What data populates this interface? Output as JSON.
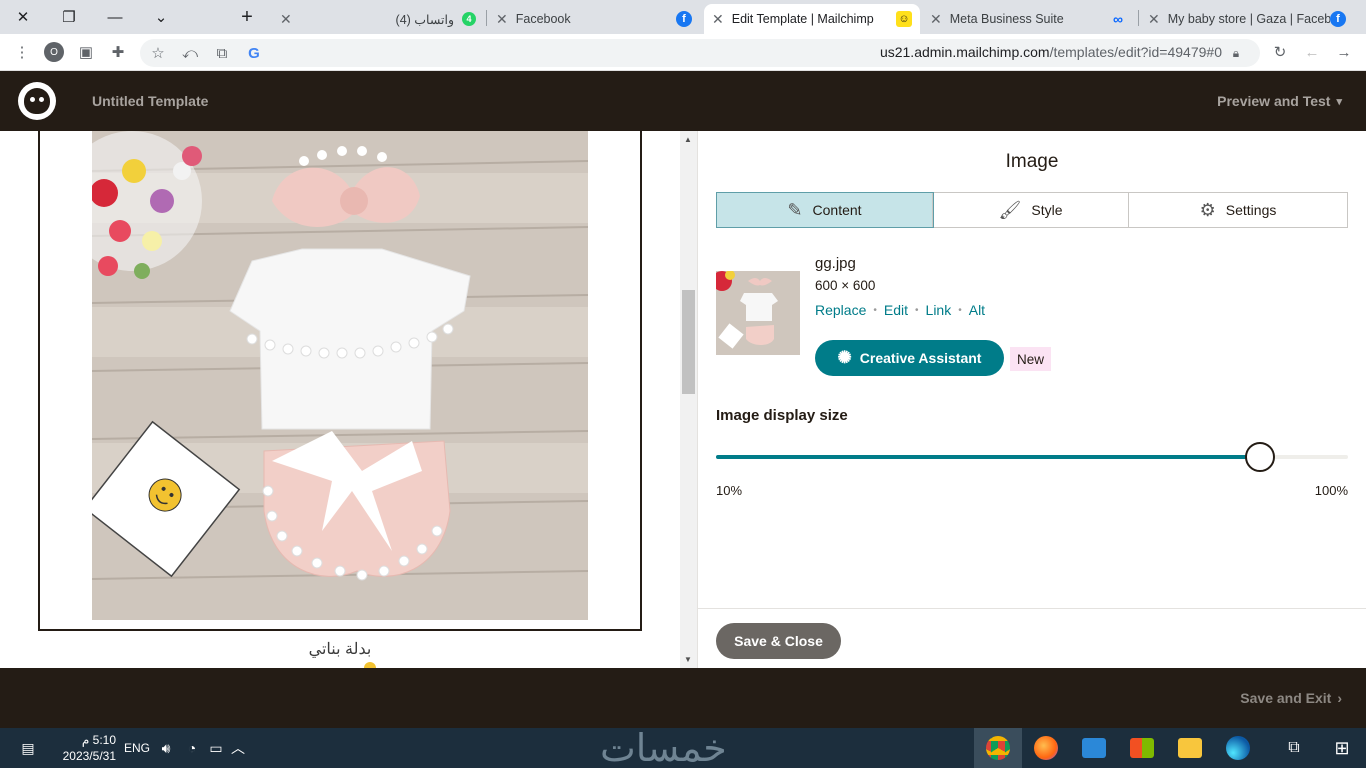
{
  "browser": {
    "tabs": [
      {
        "title": "واتساب (4)",
        "favicon": "whatsapp-icon",
        "badge": "4",
        "active": false
      },
      {
        "title": "Facebook",
        "favicon": "facebook-icon",
        "active": false
      },
      {
        "title": "Edit Template | Mailchimp",
        "favicon": "mailchimp-icon",
        "active": true
      },
      {
        "title": "Meta Business Suite",
        "favicon": "meta-icon",
        "active": false
      },
      {
        "title": "My baby store | Gaza | Faceb",
        "favicon": "facebook-icon",
        "active": false
      }
    ],
    "profile_initial": "O",
    "url_host": "us21.admin.mailchimp.com",
    "url_path": "/templates/edit?id=49479#0"
  },
  "header": {
    "template_title": "Untitled Template",
    "preview_label": "Preview and Test"
  },
  "canvas": {
    "caption": "بدلة بناتي"
  },
  "panel": {
    "title": "Image",
    "tabs": [
      {
        "label": "Content",
        "icon": "pencil-icon",
        "active": true
      },
      {
        "label": "Style",
        "icon": "brush-icon",
        "active": false
      },
      {
        "label": "Settings",
        "icon": "gear-icon",
        "active": false
      }
    ],
    "file": {
      "name": "gg.jpg",
      "dimensions": "600 × 600",
      "actions": [
        "Replace",
        "Edit",
        "Link",
        "Alt"
      ]
    },
    "creative_assistant_label": "Creative Assistant",
    "new_badge": "New",
    "display_size_label": "Image display size",
    "slider": {
      "min_label": "10%",
      "max_label": "100%",
      "value_fraction": 0.86
    },
    "save_close_label": "Save & Close"
  },
  "footer": {
    "save_exit_label": "Save and Exit"
  },
  "taskbar": {
    "time": "5:10 م",
    "date": "2023/5/31",
    "language": "ENG",
    "watermark": "خمسات"
  },
  "colors": {
    "brand_dark": "#241c15",
    "teal": "#007c89",
    "active_tab_bg": "#c6e4e8",
    "new_badge_bg": "#fbe3f3"
  }
}
